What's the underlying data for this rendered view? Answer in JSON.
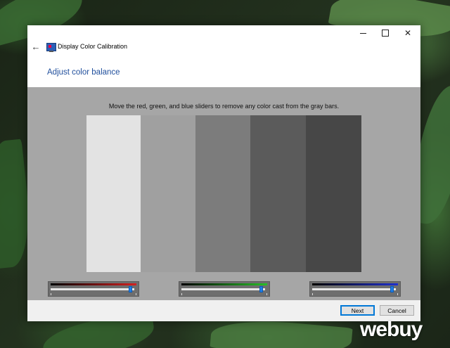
{
  "window": {
    "title": "Display Color Calibration",
    "controls": {
      "minimize": "minimize",
      "maximize": "maximize",
      "close": "✕"
    }
  },
  "page": {
    "heading": "Adjust color balance",
    "instruction": "Move the red, green, and blue sliders to remove any color cast from the gray bars."
  },
  "gray_bars": [
    {
      "color": "#e3e3e3"
    },
    {
      "color": "#a0a0a0"
    },
    {
      "color": "#7c7c7c"
    },
    {
      "color": "#5b5b5b"
    },
    {
      "color": "#474747"
    }
  ],
  "sliders": [
    {
      "channel": "red",
      "gradient_end": "#d42020",
      "level": 0.97
    },
    {
      "channel": "green",
      "gradient_end": "#28c028",
      "level": 0.97
    },
    {
      "channel": "blue",
      "gradient_end": "#2030d0",
      "level": 0.97
    }
  ],
  "buttons": {
    "next": "Next",
    "cancel": "Cancel"
  },
  "watermark": "webuy",
  "icons": {
    "back": "back-arrow-icon",
    "app": "display-calibration-icon"
  }
}
